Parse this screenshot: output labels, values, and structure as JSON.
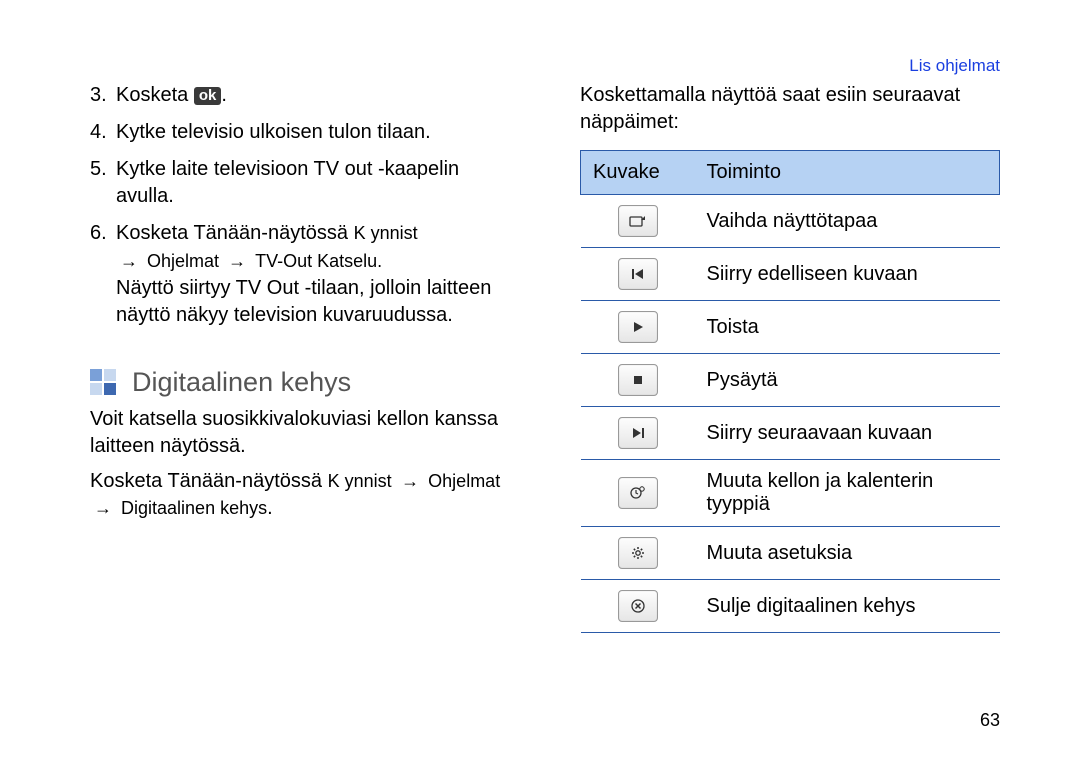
{
  "header_link": "Lis ohjelmat",
  "left": {
    "steps": [
      {
        "n": "3.",
        "text": "Kosketa",
        "after_icon": "."
      },
      {
        "n": "4.",
        "text": "Kytke televisio ulkoisen tulon tilaan."
      },
      {
        "n": "5.",
        "text": "Kytke laite televisioon TV out -kaapelin avulla."
      },
      {
        "n": "6.",
        "text": "Kosketa Tänään-näytössä ",
        "path_prefix": "K ynnist",
        "path_sep": " → ",
        "path_a": "Ohjelmat",
        "path_b": "TV-Out Katselu",
        "path_end": "."
      }
    ],
    "tvout_note": "Näyttö siirtyy TV Out -tilaan, jolloin laitteen näyttö näkyy television kuvaruudussa.",
    "h2": "Digitaalinen kehys",
    "desc": "Voit katsella suosikkivalokuviasi kellon kanssa laitteen näytössä.",
    "launch_prefix": "Kosketa Tänään-näytössä ",
    "launch_kynnist": "K ynnist",
    "launch_arrow": " → ",
    "launch_ohjelmat": "Ohjelmat",
    "launch_target": "Digitaalinen kehys",
    "launch_end": "."
  },
  "right": {
    "intro": "Koskettamalla näyttöä saat esiin seuraavat näppäimet:",
    "th_icon": "Kuvake",
    "th_func": "Toiminto",
    "rows": [
      {
        "icon": "rotate",
        "label": "Vaihda näyttötapaa"
      },
      {
        "icon": "prev",
        "label": "Siirry edelliseen kuvaan"
      },
      {
        "icon": "play",
        "label": "Toista"
      },
      {
        "icon": "stop",
        "label": "Pysäytä"
      },
      {
        "icon": "next",
        "label": "Siirry seuraavaan kuvaan"
      },
      {
        "icon": "clock",
        "label": "Muuta kellon ja kalenterin tyyppiä"
      },
      {
        "icon": "gear",
        "label": "Muuta asetuksia"
      },
      {
        "icon": "close",
        "label": "Sulje digitaalinen kehys"
      }
    ]
  },
  "page_number": "63",
  "ok_label": "ok"
}
